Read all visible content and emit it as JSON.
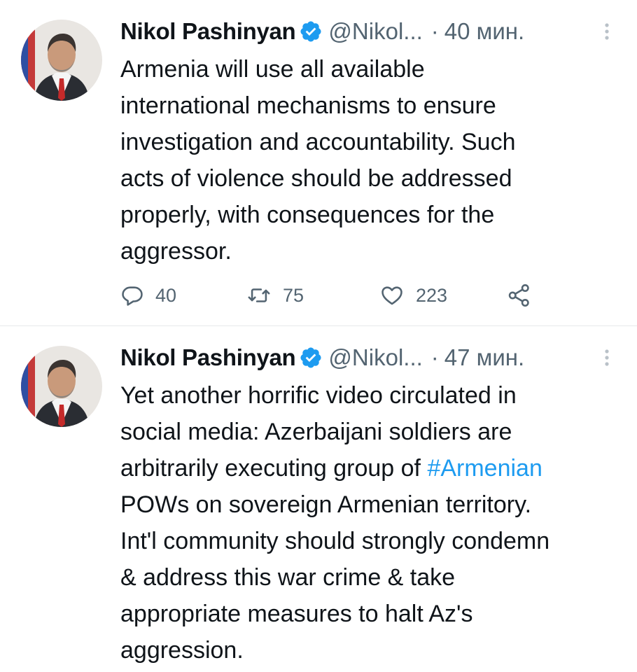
{
  "tweets": [
    {
      "author_name": "Nikol Pashinyan",
      "verified_icon": "verified-badge-icon",
      "handle": "@Nikol...",
      "separator": "·",
      "time": "40 мин.",
      "text_lines": [
        "Armenia will use all available",
        "international mechanisms to ensure",
        "investigation and accountability. Such",
        "acts of violence should be addressed",
        "properly, with consequences for the",
        "aggressor."
      ],
      "replies": "40",
      "retweets": "75",
      "likes": "223"
    },
    {
      "author_name": "Nikol Pashinyan",
      "verified_icon": "verified-badge-icon",
      "handle": "@Nikol...",
      "separator": "·",
      "time": "47 мин.",
      "text_before_hashtag": "Yet another horrific video circulated in\nsocial media: Azerbaijani soldiers are\narbitrarily executing group of ",
      "hashtag": "#Armenian",
      "text_after_hashtag": "\nPOWs on sovereign Armenian territory.\nInt'l community should strongly condemn\n& address this war crime & take\nappropriate measures to halt Az's\naggression."
    }
  ],
  "colors": {
    "accent": "#1d9bf0",
    "secondary_text": "#536471",
    "primary_text": "#0f1419"
  }
}
